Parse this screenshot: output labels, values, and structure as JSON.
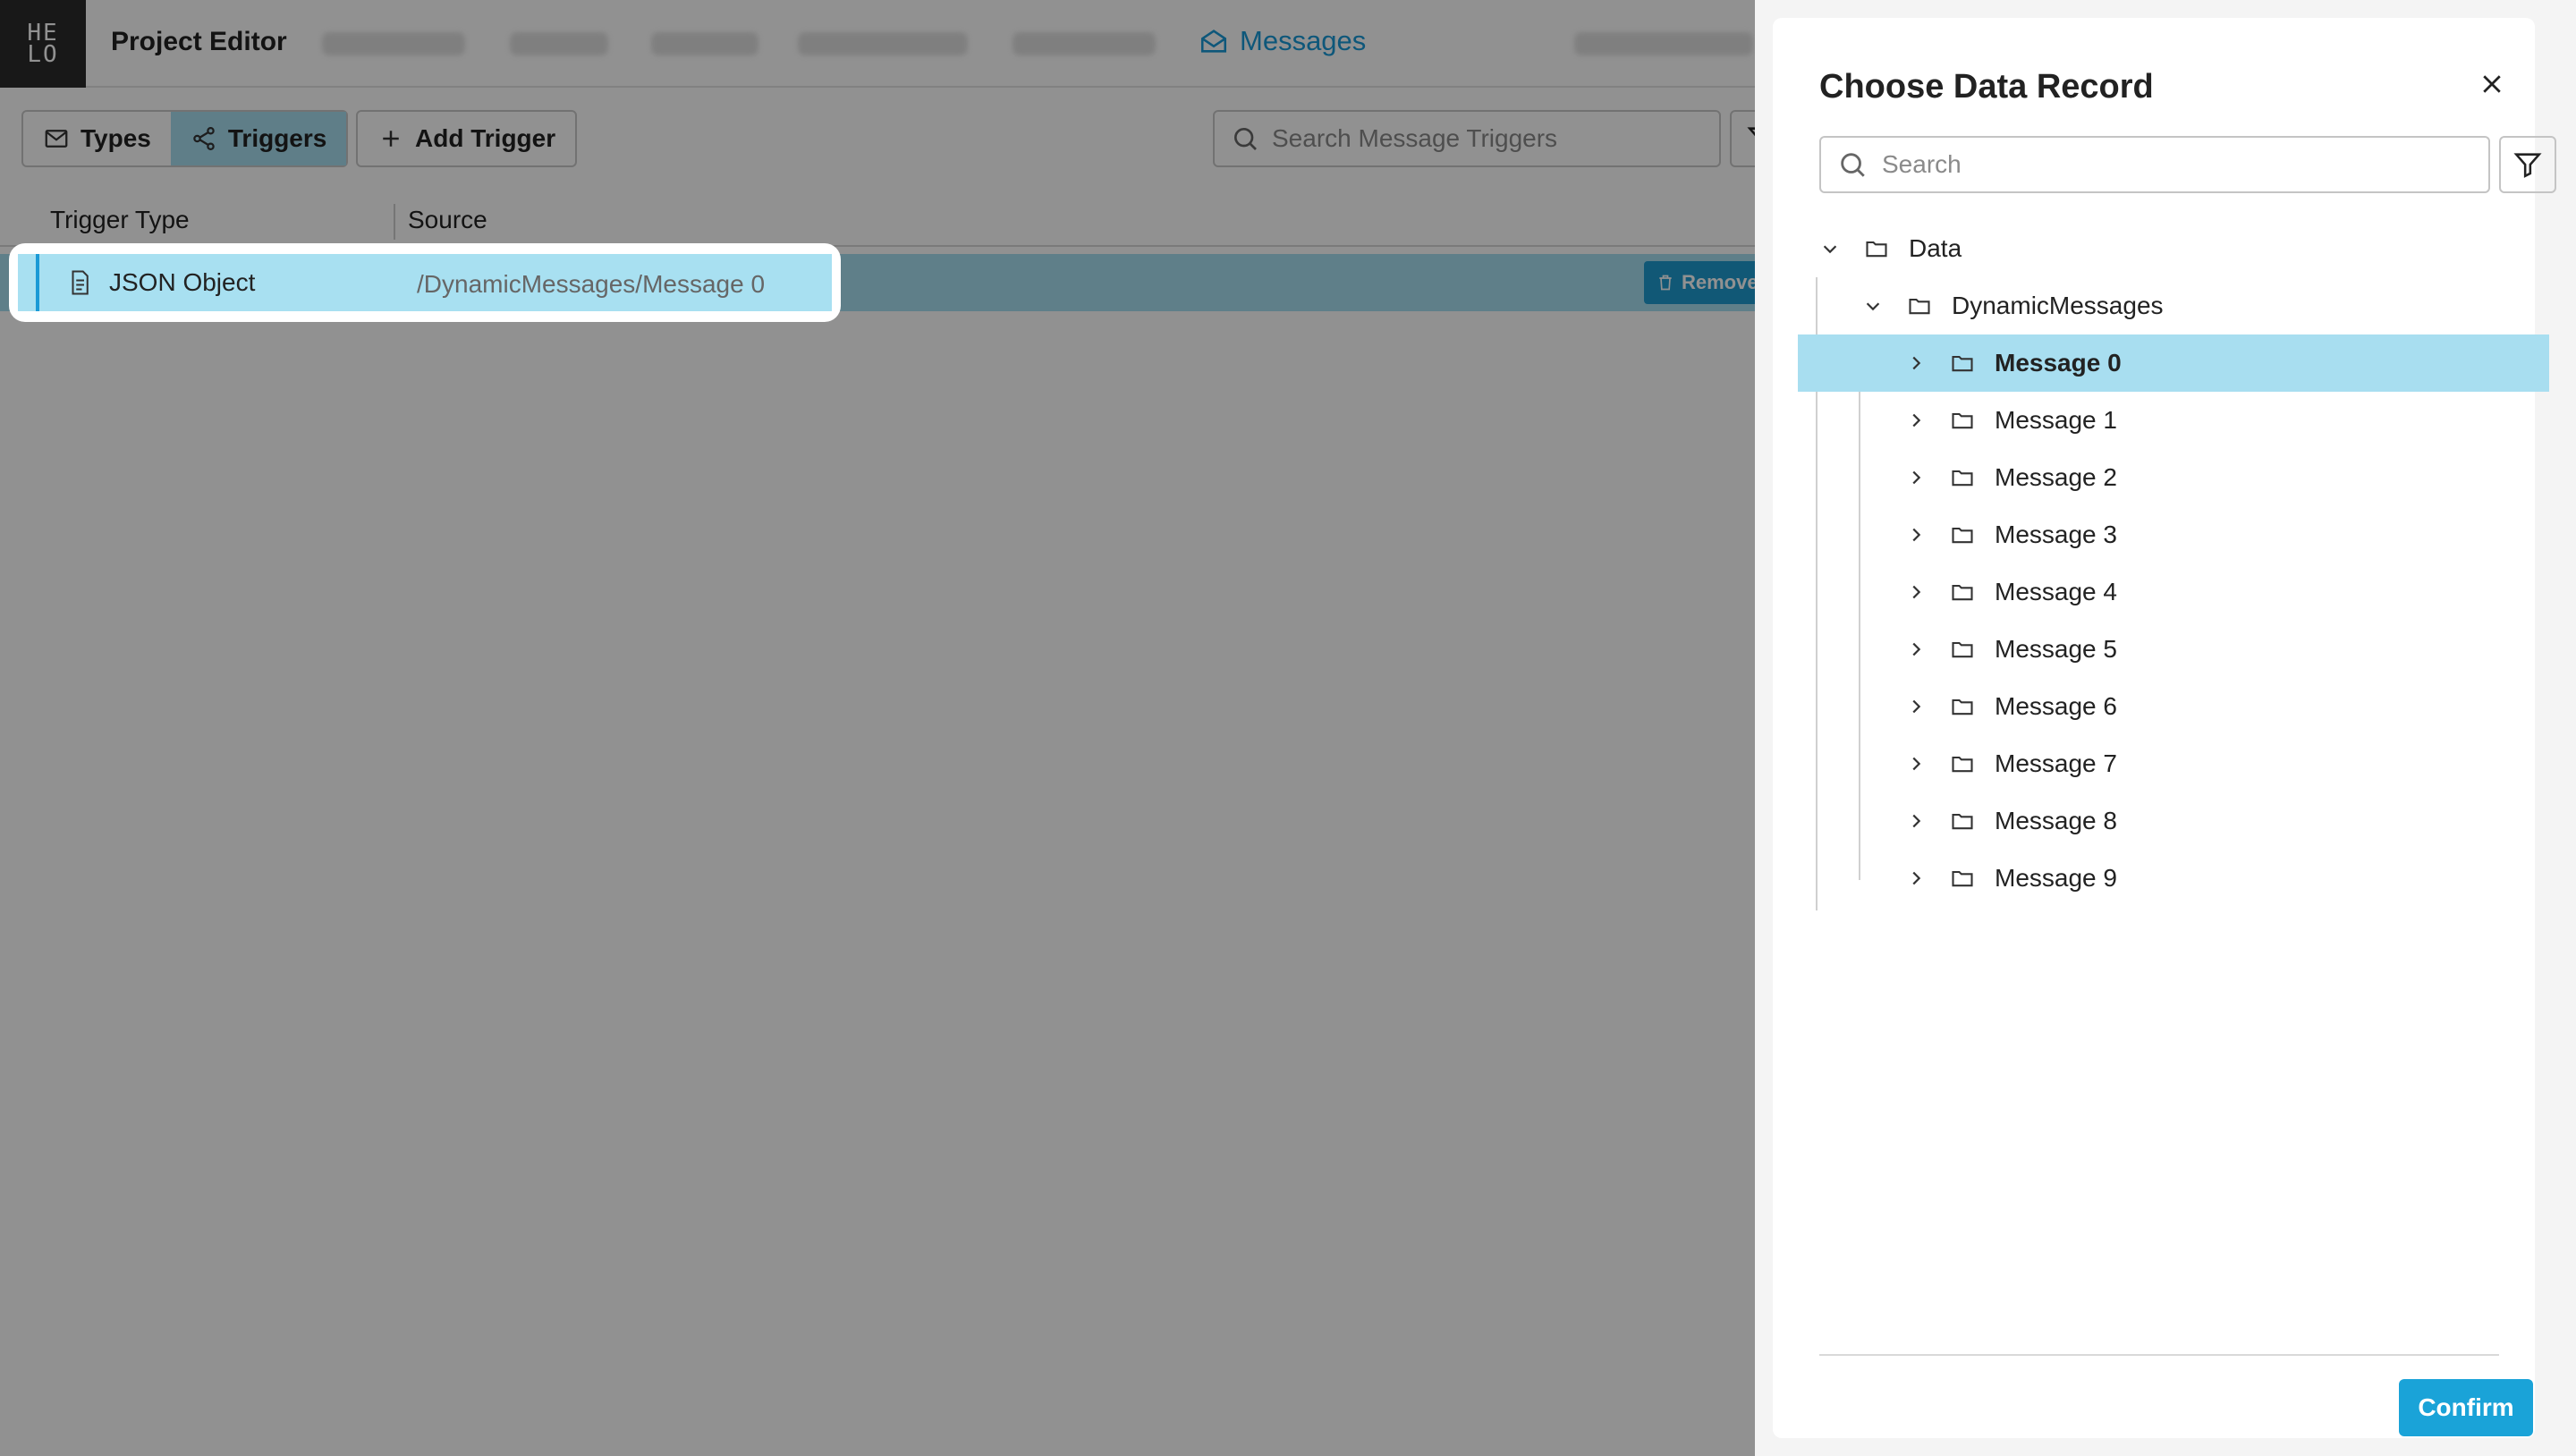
{
  "app": {
    "logo_text_top": "HE",
    "logo_text_bottom": "LO",
    "title": "Project Editor",
    "nav_messages": "Messages"
  },
  "toolbar": {
    "types_label": "Types",
    "triggers_label": "Triggers",
    "add_trigger_label": "Add Trigger",
    "search_placeholder": "Search Message Triggers"
  },
  "table": {
    "headers": [
      "Trigger Type",
      "Source"
    ],
    "rows": [
      {
        "type": "JSON Object",
        "source": "/DynamicMessages/Message 0",
        "action": "Remove"
      }
    ]
  },
  "panel": {
    "title": "Choose Data Record",
    "search_placeholder": "Search",
    "tree": {
      "root": "Data",
      "child": "DynamicMessages",
      "items": [
        "Message 0",
        "Message 1",
        "Message 2",
        "Message 3",
        "Message 4",
        "Message 5",
        "Message 6",
        "Message 7",
        "Message 8",
        "Message 9"
      ],
      "selected": "Message 0"
    },
    "confirm_label": "Confirm"
  },
  "colors": {
    "accent": "#1a9ad6",
    "selection": "#a8def0",
    "confirm": "#1aa3d8"
  }
}
